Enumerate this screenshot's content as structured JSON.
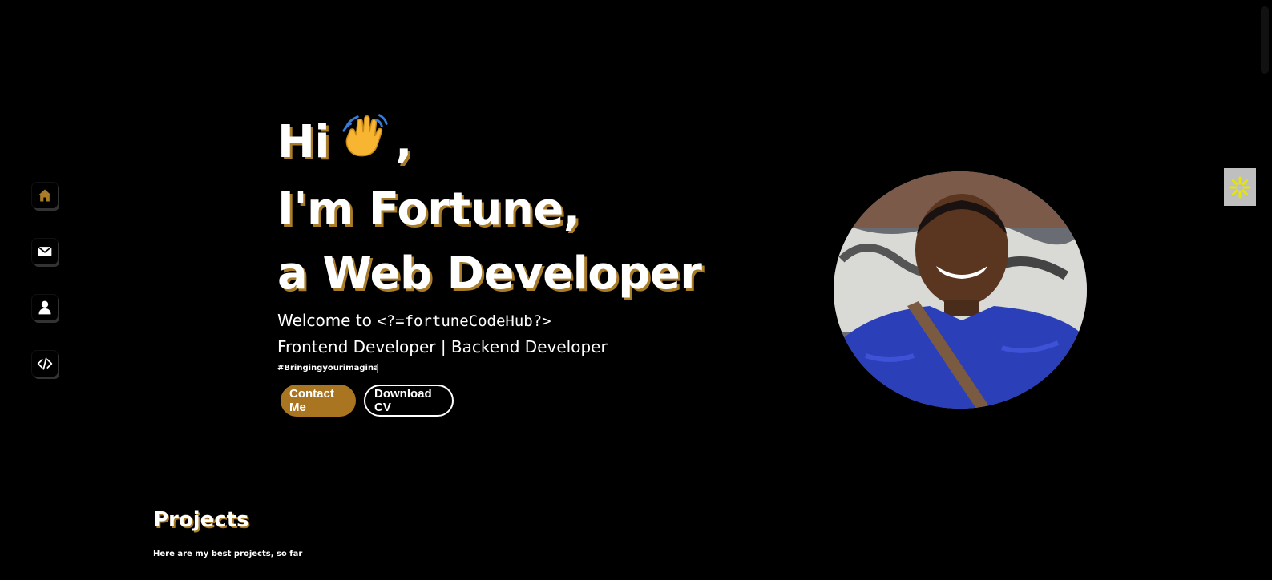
{
  "nav": {
    "items": [
      {
        "icon": "home-icon",
        "color": "#a97c28"
      },
      {
        "icon": "envelope-icon",
        "color": "#ffffff"
      },
      {
        "icon": "user-icon",
        "color": "#ffffff"
      },
      {
        "icon": "code-icon",
        "color": "#ffffff"
      }
    ]
  },
  "hero": {
    "line1_prefix": "Hi",
    "line1_suffix": ",",
    "line2": "I'm Fortune,",
    "line3": "a Web Developer",
    "welcome_prefix": "Welcome to",
    "brand": "<?=fortuneCodeHub?>",
    "roles": "Frontend Developer | Backend Developer",
    "hashtag": "#Bringingyourimaginations",
    "contact_label": "Contact Me",
    "cv_label": "Download CV"
  },
  "projects": {
    "title": "Projects",
    "subtitle": "Here are my best projects, so far"
  },
  "colors": {
    "accent": "#a97c28",
    "background": "#000000",
    "toggle": "#bfbfbf",
    "toggle_icon": "#e6e600"
  }
}
